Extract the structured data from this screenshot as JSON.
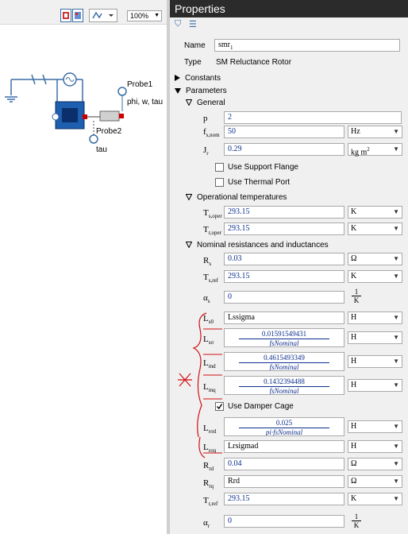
{
  "left_panel": {
    "zoom": "100%",
    "labels": {
      "probe1": "Probe1",
      "probe2": "Probe2",
      "signals": "phi, w, tau",
      "tau": "tau"
    }
  },
  "properties": {
    "title": "Properties",
    "name_label": "Name",
    "name_value": "smr",
    "name_sub": "1",
    "type_label": "Type",
    "type_value": "SM Reluctance Rotor",
    "constants_label": "Constants",
    "parameters_label": "Parameters",
    "general": {
      "label": "General",
      "p": {
        "sym": "p",
        "value": "2"
      },
      "fsnom": {
        "sym": "f",
        "sub": "s,nom",
        "value": "50",
        "unit": "Hz"
      },
      "jr": {
        "sym": "J",
        "sub": "r",
        "value": "0.29",
        "unit": "kg m",
        "unit_sup": "2"
      },
      "support_flange": "Use Support Flange",
      "thermal_port": "Use Thermal Port"
    },
    "operational": {
      "label": "Operational temperatures",
      "tsoper": {
        "sym": "T",
        "sub": "s,oper",
        "value": "293.15",
        "unit": "K"
      },
      "troper": {
        "sym": "T",
        "sub": "r,oper",
        "value": "293.15",
        "unit": "K"
      }
    },
    "nominal": {
      "label": "Nominal resistances and inductances",
      "rs": {
        "sym": "R",
        "sub": "s",
        "value": "0.03",
        "unit": "Ω"
      },
      "tsref": {
        "sym": "T",
        "sub": "s,ref",
        "value": "293.15",
        "unit": "K"
      },
      "alphas": {
        "sym": "α",
        "sub": "s",
        "value": "0",
        "unit_num": "1",
        "unit_den": "K"
      },
      "ls0": {
        "sym": "L",
        "sub": "s0",
        "value": "Lssigma",
        "unit": "H"
      },
      "lszero": {
        "sym": "L",
        "sub": "sσ",
        "num": "0.01591549431",
        "den": "fsNominal",
        "unit": "H"
      },
      "lmd": {
        "sym": "L",
        "sub": "md",
        "num": "0.4615493349",
        "den": "fsNominal",
        "unit": "H"
      },
      "lmq": {
        "sym": "L",
        "sub": "mq",
        "num": "0.1432394488",
        "den": "fsNominal",
        "unit": "H"
      },
      "damper_cage": "Use Damper Cage",
      "lrsd": {
        "sym": "L",
        "sub": "rσd",
        "num": "0.025",
        "den": "pi·fsNominal",
        "unit": "H"
      },
      "lrsq": {
        "sym": "L",
        "sub": "rσq",
        "value": "Lrsigmad",
        "unit": "H"
      },
      "rrd": {
        "sym": "R",
        "sub": "rd",
        "value": "0.04",
        "unit": "Ω"
      },
      "rrq": {
        "sym": "R",
        "sub": "rq",
        "value": "Rrd",
        "unit": "Ω"
      },
      "trref": {
        "sym": "T",
        "sub": "r,ref",
        "value": "293.15",
        "unit": "K"
      },
      "alphar": {
        "sym": "α",
        "sub": "r",
        "value": "0",
        "unit_num": "1",
        "unit_den": "K"
      }
    }
  }
}
